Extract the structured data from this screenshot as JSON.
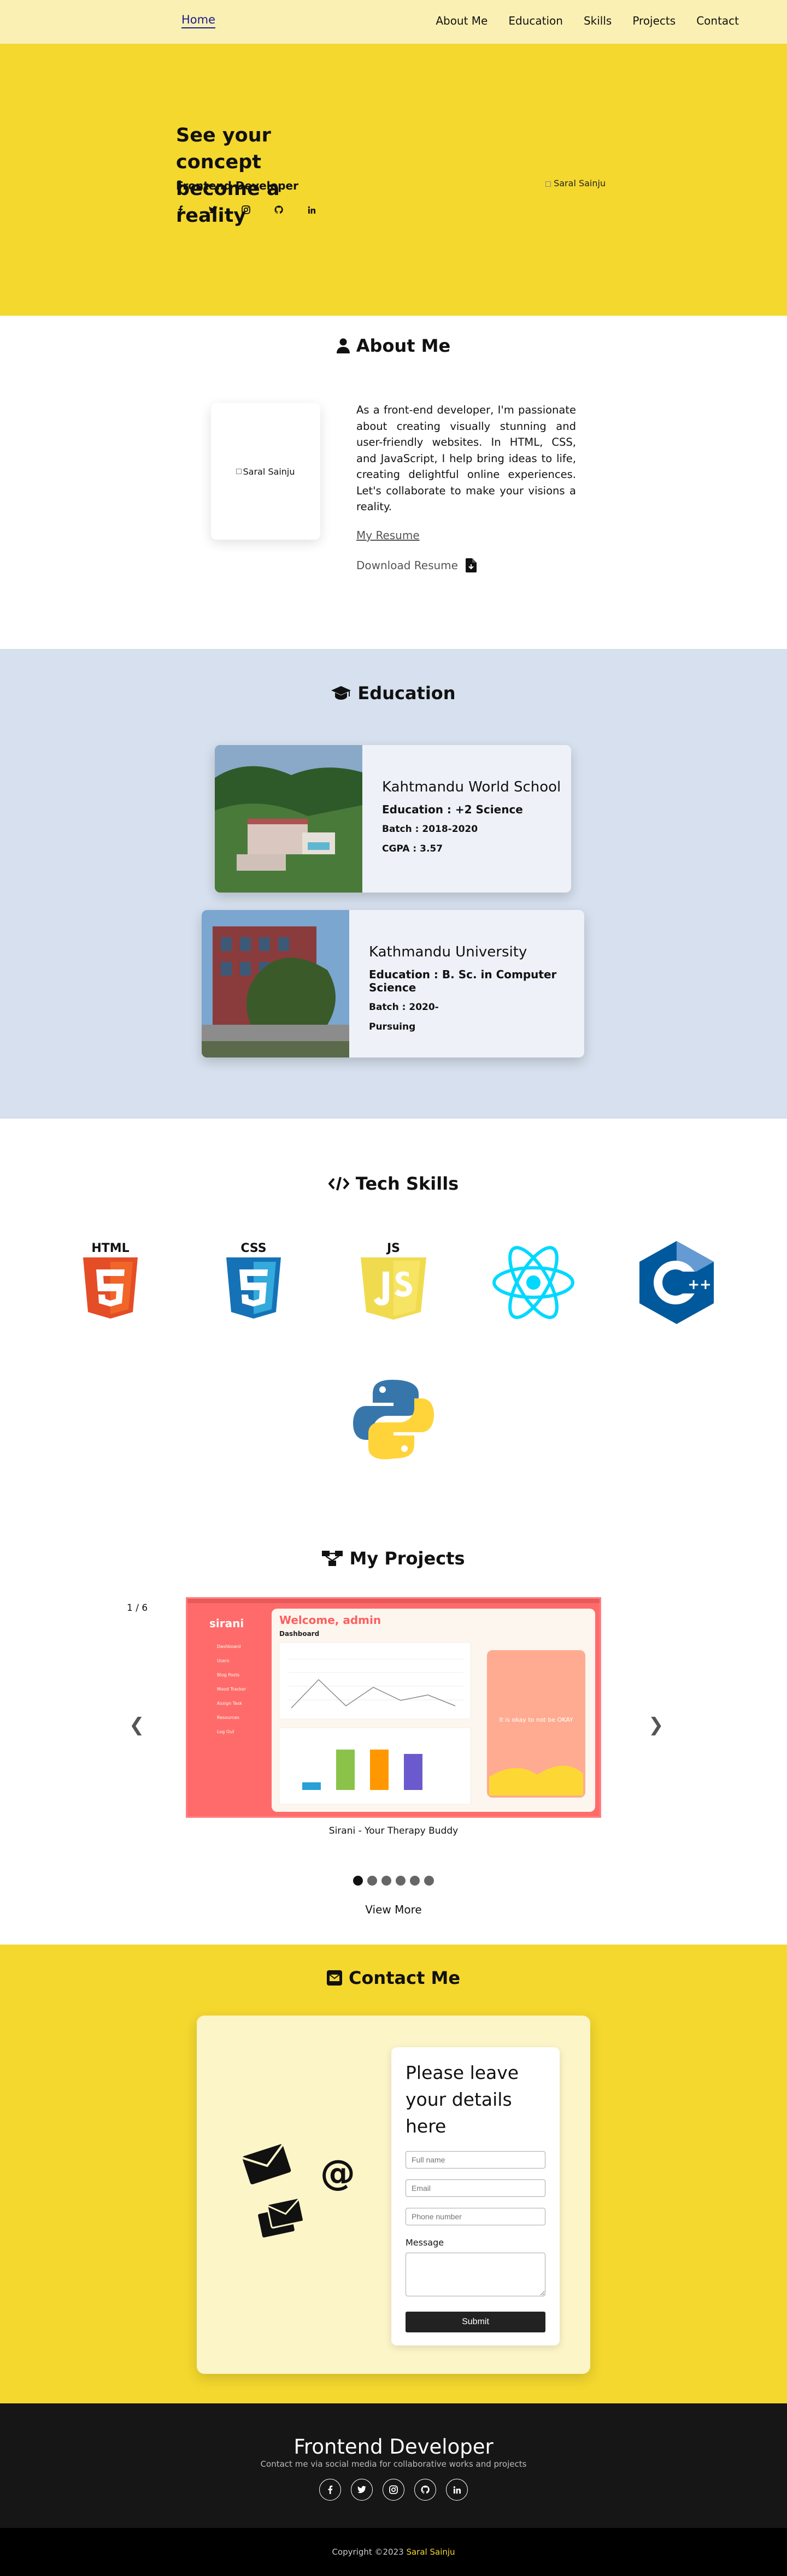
{
  "nav": {
    "home": "Home",
    "links": [
      "About Me",
      "Education",
      "Skills",
      "Projects",
      "Contact"
    ]
  },
  "hero": {
    "headline": "See your concept become a reality",
    "role": "Frontend Developer",
    "socials": [
      "facebook-icon",
      "twitter-icon",
      "instagram-icon",
      "github-icon",
      "linkedin-icon"
    ],
    "portrait_alt": "Saral Sainju"
  },
  "about": {
    "title": "About Me",
    "photo_alt": "Saral Sainju",
    "text": "As a front-end developer, I'm passionate about creating visually stunning and user-friendly websites. In HTML, CSS, and JavaScript, I help bring ideas to life, creating delightful online experiences. Let's collaborate to make your visions a reality.",
    "resume": "My Resume",
    "download": "Download Resume"
  },
  "education": {
    "title": "Education",
    "cards": [
      {
        "name": "Kahtmandu World School",
        "education": "Education : +2 Science",
        "batch": "Batch : 2018-2020",
        "extra": "CGPA : 3.57"
      },
      {
        "name": "Kathmandu University",
        "education": "Education : B. Sc. in Computer Science",
        "batch": "Batch : 2020-",
        "extra": "Pursuing"
      }
    ]
  },
  "skills": {
    "title": "Tech Skills",
    "items": [
      "HTML5",
      "CSS3",
      "JS",
      "React",
      "C++",
      "Python"
    ]
  },
  "projects": {
    "title": "My Projects",
    "counter": "1 / 6",
    "prev": "❮",
    "next": "❯",
    "caption": "Sirani - Your Therapy Buddy",
    "more": "View More",
    "slides": 6,
    "active": 1,
    "screenshot": {
      "brand": "sirani",
      "welcome": "Welcome, admin",
      "dashboard": "Dashboard",
      "promo": "It is okay to not be OKAY",
      "menu": [
        "Dashboard",
        "Users",
        "Blog Posts",
        "Mood Tracker",
        "Assign Task",
        "Resources",
        "Log Out"
      ]
    }
  },
  "contact": {
    "title": "Contact Me",
    "heading": "Please leave your details here",
    "fullname": "Full name",
    "email": "Email",
    "phone": "Phone number",
    "message": "Message",
    "submit": "Submit"
  },
  "footer": {
    "title": "Frontend Developer",
    "subtitle": "Contact me via social media for collaborative works and projects",
    "copyright": "Copyright ©2023",
    "name": "Saral Sainju"
  }
}
